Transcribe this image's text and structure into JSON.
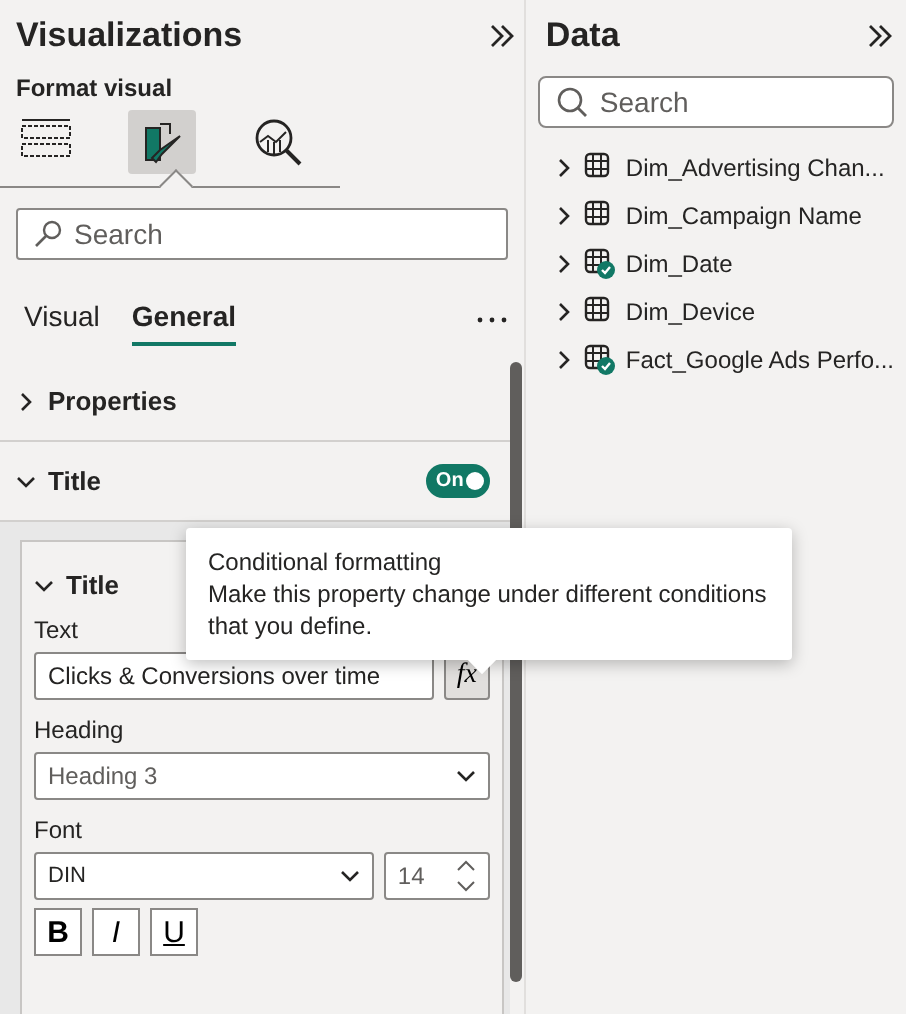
{
  "visualizations": {
    "title": "Visualizations",
    "subtitle": "Format visual",
    "icon_tabs": [
      {
        "kind": "fields",
        "selected": false
      },
      {
        "kind": "format",
        "selected": true
      },
      {
        "kind": "analytics",
        "selected": false
      }
    ],
    "search": {
      "placeholder": "Search"
    },
    "tabs": [
      {
        "label": "Visual",
        "selected": false
      },
      {
        "label": "General",
        "selected": true
      }
    ],
    "sections": [
      {
        "label": "Properties",
        "expanded": false
      },
      {
        "label": "Title",
        "expanded": true,
        "toggle": {
          "label": "On",
          "on": true
        }
      }
    ],
    "card": {
      "title": "Title",
      "expanded": true,
      "text_field": {
        "label": "Text",
        "value": "Clicks & Conversions over time",
        "fx": "fx"
      },
      "heading": {
        "label": "Heading",
        "value": "Heading 3"
      },
      "font": {
        "label": "Font",
        "family": "DIN",
        "size": "14"
      },
      "styles": [
        {
          "kind": "bold",
          "label": "B"
        },
        {
          "kind": "italic",
          "label": "I"
        },
        {
          "kind": "underline",
          "label": "U"
        }
      ]
    }
  },
  "tooltip": {
    "title": "Conditional formatting",
    "body": "Make this property change under different conditions that you define."
  },
  "data": {
    "title": "Data",
    "search": {
      "placeholder": "Search"
    },
    "tables": [
      {
        "name": "Dim_Advertising Chan...",
        "in_use": false,
        "expanded": false
      },
      {
        "name": "Dim_Campaign Name",
        "in_use": false,
        "expanded": false
      },
      {
        "name": "Dim_Date",
        "in_use": true,
        "expanded": false
      },
      {
        "name": "Dim_Device",
        "in_use": false,
        "expanded": false
      },
      {
        "name": "Fact_Google Ads Perfo...",
        "in_use": true,
        "expanded": false
      }
    ]
  }
}
